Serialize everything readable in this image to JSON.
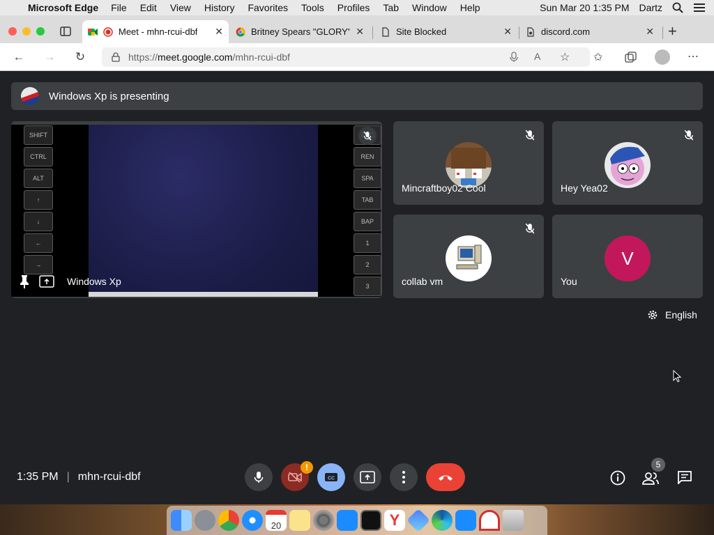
{
  "menubar": {
    "app_name": "Microsoft Edge",
    "items": [
      "File",
      "Edit",
      "View",
      "History",
      "Favorites",
      "Tools",
      "Profiles",
      "Tab",
      "Window",
      "Help"
    ],
    "clock": "Sun Mar 20  1:35 PM",
    "user": "Dartz"
  },
  "tabs": [
    {
      "title": "Meet - mhn-rcui-dbf"
    },
    {
      "title": "Britney Spears \"GLORY\""
    },
    {
      "title": "Site Blocked"
    },
    {
      "title": "discord.com"
    }
  ],
  "address": {
    "prefix": "https://",
    "host": "meet.google.com",
    "path": "/mhn-rcui-dbf"
  },
  "banner": {
    "text": "Windows Xp is presenting"
  },
  "presentation": {
    "owner": "Windows Xp",
    "left_keys": [
      "SHIFT",
      "CTRL",
      "ALT",
      "↑",
      "↓",
      "←",
      "→"
    ],
    "right_keys": [
      "ESC",
      "REN",
      "SPA",
      "TAB",
      "BAP",
      "1",
      "2",
      "3"
    ]
  },
  "participants": [
    {
      "name": "Mincraftboy02 Cool",
      "muted": true
    },
    {
      "name": "Hey Yea02",
      "muted": true
    },
    {
      "name": "collab vm",
      "muted": true
    },
    {
      "name": "You",
      "initial": "V",
      "avatar_color": "#c2185b"
    }
  ],
  "language": {
    "label": "English"
  },
  "bottom": {
    "time": "1:35 PM",
    "divider": "|",
    "meeting_code": "mhn-rcui-dbf",
    "people_count": "5",
    "camera_alert": "!"
  },
  "colors": {
    "meet_bg": "#202124",
    "tile_bg": "#3c4043",
    "end_call": "#ea4335",
    "captions": "#8ab4f8"
  },
  "dock": {
    "calendar_day": "20"
  }
}
